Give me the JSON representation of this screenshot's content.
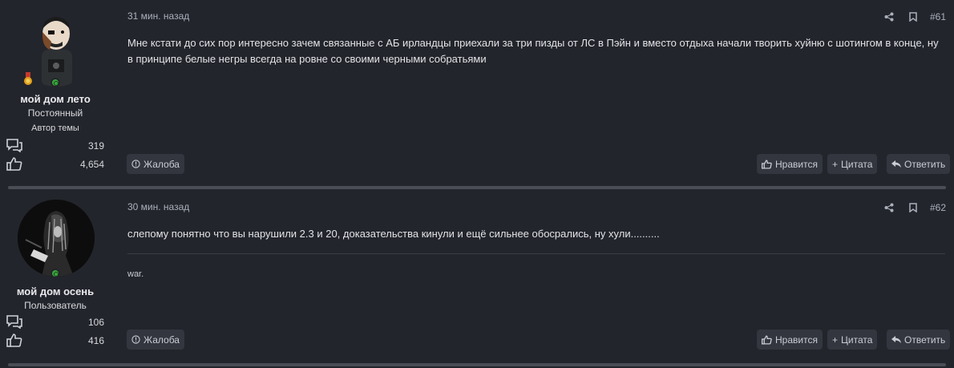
{
  "posts": [
    {
      "author": {
        "name": "мой дом лето",
        "title": "Постоянный",
        "badge": "Автор темы",
        "messages": "319",
        "reactions": "4,654"
      },
      "time": "31 мин. назад",
      "number": "#61",
      "body": "Мне кстати до сих пор интересно зачем связанные с АБ ирландцы приехали за три пизды от ЛС в Пэйн и вместо отдыха начали творить хуйню с шотингом в конце, ну в принципе белые негры всегда на ровне со своими черными собратьями",
      "signature": "",
      "actions": {
        "report": "Жалоба",
        "like": "Нравится",
        "quote": "Цитата",
        "reply": "Ответить"
      }
    },
    {
      "author": {
        "name": "мой дом осень",
        "title": "Пользователь",
        "badge": "",
        "messages": "106",
        "reactions": "416"
      },
      "time": "30 мин. назад",
      "number": "#62",
      "body": "слепому понятно что вы нарушили 2.3 и 20, доказательства кинули и ещё сильнее обосрались, ну хули..........",
      "signature": "war.",
      "actions": {
        "report": "Жалоба",
        "like": "Нравится",
        "quote": "Цитата",
        "reply": "Ответить"
      }
    }
  ],
  "icons": {
    "share": "share-icon",
    "bookmark": "bookmark-icon",
    "messages": "messages-icon",
    "reactions": "thumbs-up-icon",
    "online": "online-status-icon",
    "medal": "medal-icon"
  },
  "colors": {
    "background": "#23252c",
    "button": "#33363e",
    "separator": "#4a4d55",
    "online": "#3aa63c"
  }
}
